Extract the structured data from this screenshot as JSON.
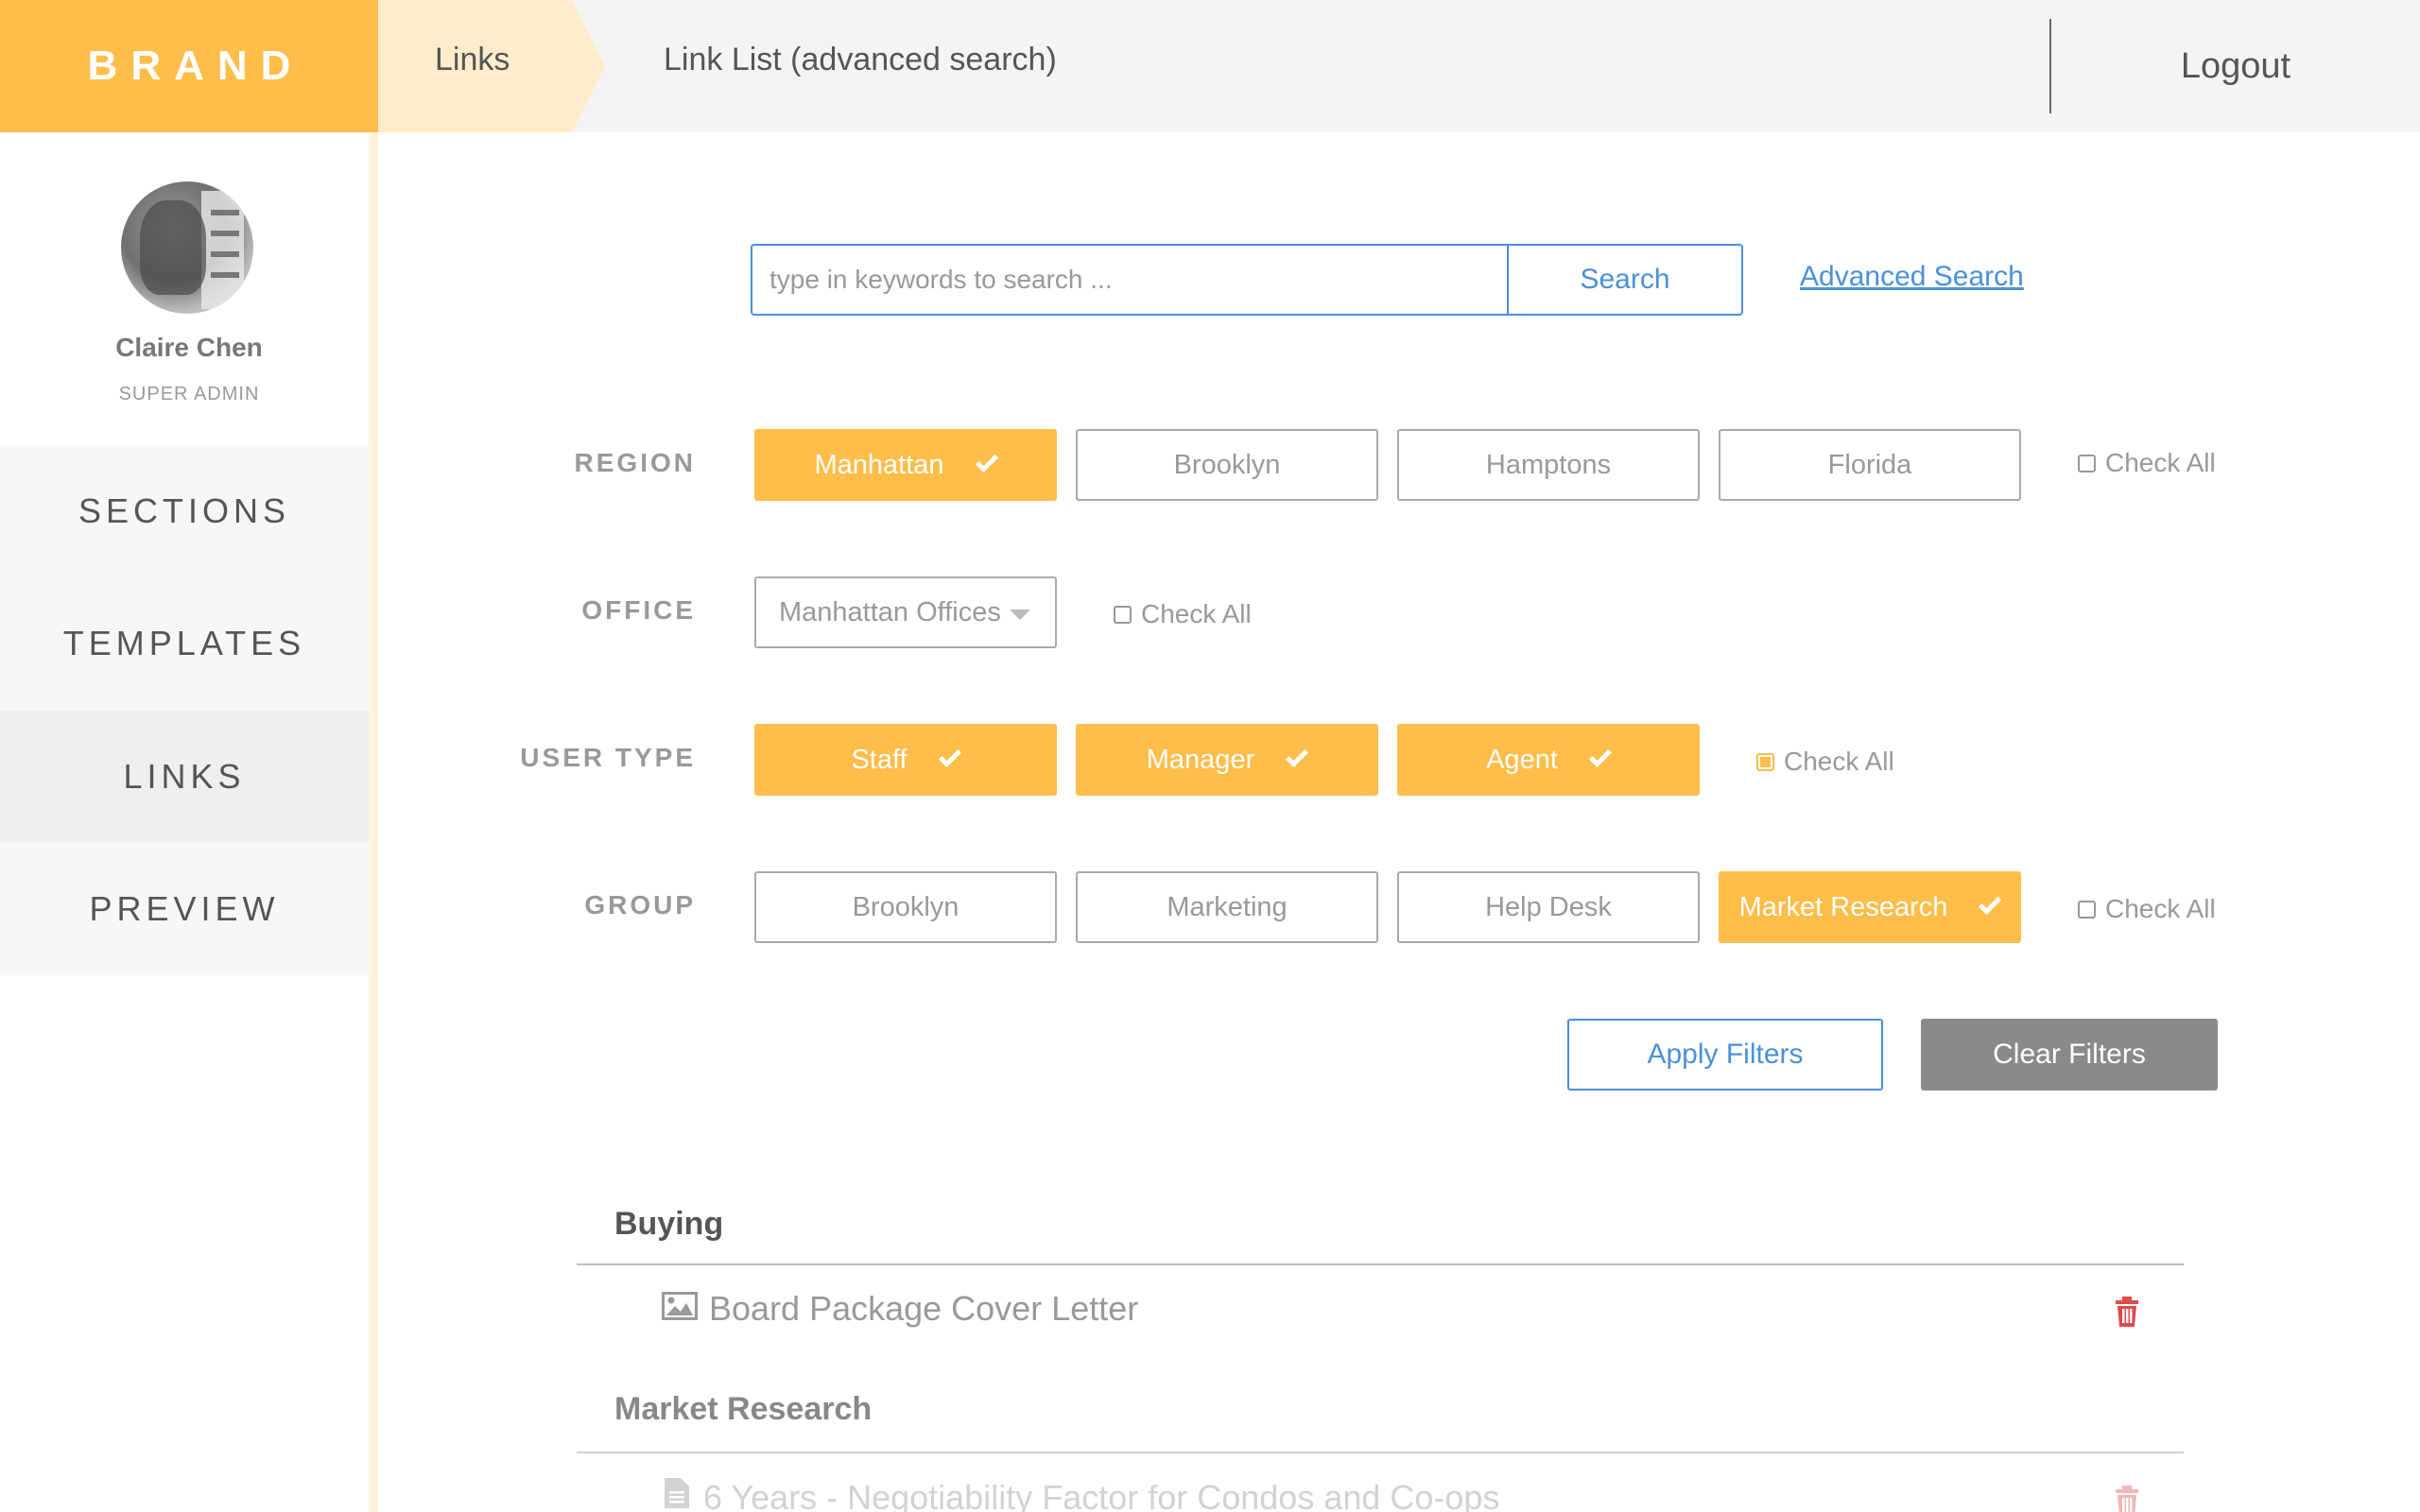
{
  "header": {
    "brand": "BRAND",
    "breadcrumb": "Links",
    "page_title": "Link List (advanced search)",
    "logout_label": "Logout"
  },
  "user": {
    "name": "Claire Chen",
    "role": "SUPER ADMIN"
  },
  "sidebar": {
    "items": [
      {
        "label": "SECTIONS",
        "active": false
      },
      {
        "label": "TEMPLATES",
        "active": false
      },
      {
        "label": "LINKS",
        "active": true
      },
      {
        "label": "PREVIEW",
        "active": false
      }
    ]
  },
  "search": {
    "placeholder": "type in keywords to search ...",
    "value": "",
    "button_label": "Search",
    "advanced_link": "Advanced Search"
  },
  "filters": {
    "region": {
      "label": "REGION",
      "options": [
        {
          "label": "Manhattan",
          "selected": true
        },
        {
          "label": "Brooklyn",
          "selected": false
        },
        {
          "label": "Hamptons",
          "selected": false
        },
        {
          "label": "Florida",
          "selected": false
        }
      ],
      "check_all_label": "Check All",
      "check_all": false
    },
    "office": {
      "label": "OFFICE",
      "selected": "Manhattan Offices",
      "check_all_label": "Check All",
      "check_all": false
    },
    "user_type": {
      "label": "USER TYPE",
      "options": [
        {
          "label": "Staff",
          "selected": true
        },
        {
          "label": "Manager",
          "selected": true
        },
        {
          "label": "Agent",
          "selected": true
        }
      ],
      "check_all_label": "Check All",
      "check_all": true
    },
    "group": {
      "label": "GROUP",
      "options": [
        {
          "label": "Brooklyn",
          "selected": false
        },
        {
          "label": "Marketing",
          "selected": false
        },
        {
          "label": "Help Desk",
          "selected": false
        },
        {
          "label": "Market Research",
          "selected": true
        }
      ],
      "check_all_label": "Check All",
      "check_all": false
    },
    "apply_label": "Apply Filters",
    "clear_label": "Clear Filters"
  },
  "link_groups": [
    {
      "title": "Buying",
      "links": [
        {
          "title": "Board Package Cover Letter",
          "icon": "image-icon"
        }
      ]
    },
    {
      "title": "Market Research",
      "links": [
        {
          "title": "6 Years - Negotiability Factor for Condos and Co-ops",
          "icon": "document-icon"
        }
      ]
    }
  ],
  "colors": {
    "accent": "#ffbd4a",
    "link_blue": "#4a90d9",
    "danger": "#e04a4a",
    "clear_button": "#8a8a8a"
  }
}
